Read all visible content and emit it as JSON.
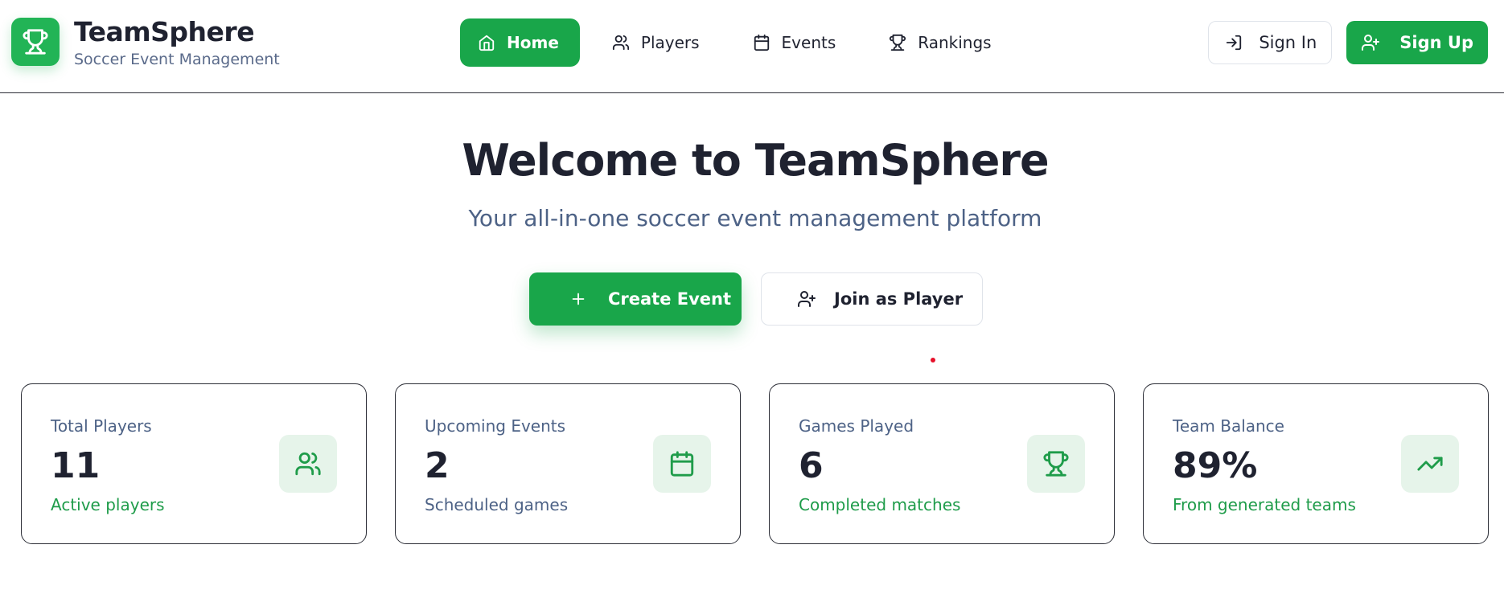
{
  "brand": {
    "name": "TeamSphere",
    "tagline": "Soccer Event Management",
    "logo_icon": "trophy-icon"
  },
  "nav": {
    "items": [
      {
        "label": "Home",
        "icon": "home-icon",
        "active": true
      },
      {
        "label": "Players",
        "icon": "users-icon",
        "active": false
      },
      {
        "label": "Events",
        "icon": "calendar-icon",
        "active": false
      },
      {
        "label": "Rankings",
        "icon": "trophy-icon",
        "active": false
      }
    ]
  },
  "auth": {
    "signin_label": "Sign In",
    "signup_label": "Sign Up"
  },
  "hero": {
    "title": "Welcome to TeamSphere",
    "subtitle": "Your all-in-one soccer event management platform",
    "create_label": "Create Event",
    "join_label": "Join as Player"
  },
  "stats": [
    {
      "label": "Total Players",
      "value": "11",
      "note": "Active players",
      "icon": "users-icon"
    },
    {
      "label": "Upcoming Events",
      "value": "2",
      "note": "Scheduled games",
      "icon": "calendar-icon"
    },
    {
      "label": "Games Played",
      "value": "6",
      "note": "Completed matches",
      "icon": "trophy-icon"
    },
    {
      "label": "Team Balance",
      "value": "89%",
      "note": "From generated teams",
      "icon": "trending-up-icon"
    }
  ],
  "colors": {
    "primary": "#19a64a",
    "primary_light": "#e6f4ea",
    "text": "#1f2230",
    "muted": "#4d6286",
    "accent_note": "#1f9c4a"
  }
}
